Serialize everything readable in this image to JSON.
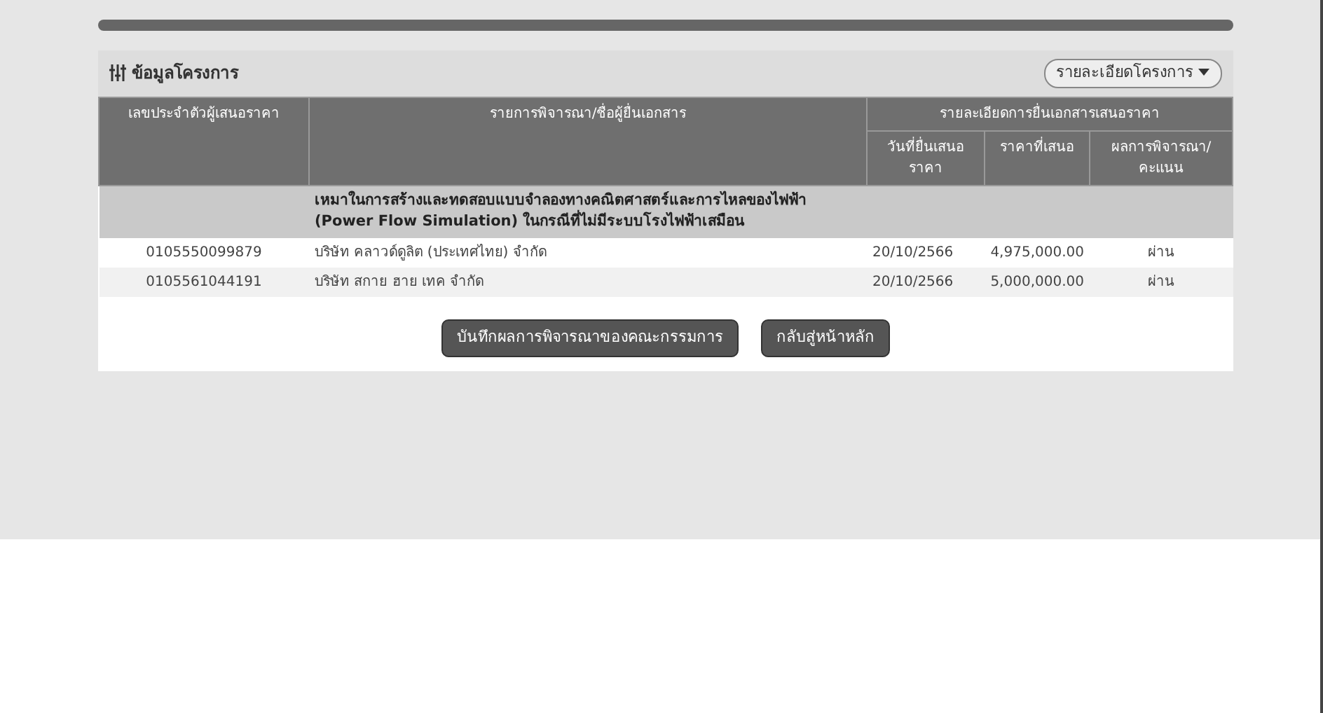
{
  "panel": {
    "title": "ข้อมูลโครงการ",
    "menu": "รายละเอียดโครงการ"
  },
  "table": {
    "columns": [
      "เลขประจำตัวผู้เสนอราคา",
      "รายการพิจารณา/ชื่อผู้ยื่นเอกสาร",
      "รายละเอียดการยื่นเอกสารเสนอราคา"
    ],
    "subcolumns": [
      "วันที่ยื่นเสนอราคา",
      "ราคาที่เสนอ",
      "ผลการพิจารณา/คะแนน"
    ],
    "project": "เหมาในการสร้างและทดสอบแบบจำลองทางคณิตศาสตร์และการไหลของไฟฟ้า (Power Flow Simulation) ในกรณีที่ไม่มีระบบโรงไฟฟ้าเสมือน",
    "rows": [
      {
        "id": "0105550099879",
        "name": "บริษัท คลาวด์ดูลิต (ประเทศไทย) จำกัด",
        "date": "20/10/2566",
        "price": "4,975,000.00",
        "result": "ผ่าน"
      },
      {
        "id": "0105561044191",
        "name": "บริษัท สกาย ฮาย เทค จำกัด",
        "date": "20/10/2566",
        "price": "5,000,000.00",
        "result": "ผ่าน"
      }
    ]
  },
  "buttons": [
    "บันทึกผลการพิจารณาของคณะกรรมการ",
    "กลับสู่หน้าหลัก"
  ]
}
